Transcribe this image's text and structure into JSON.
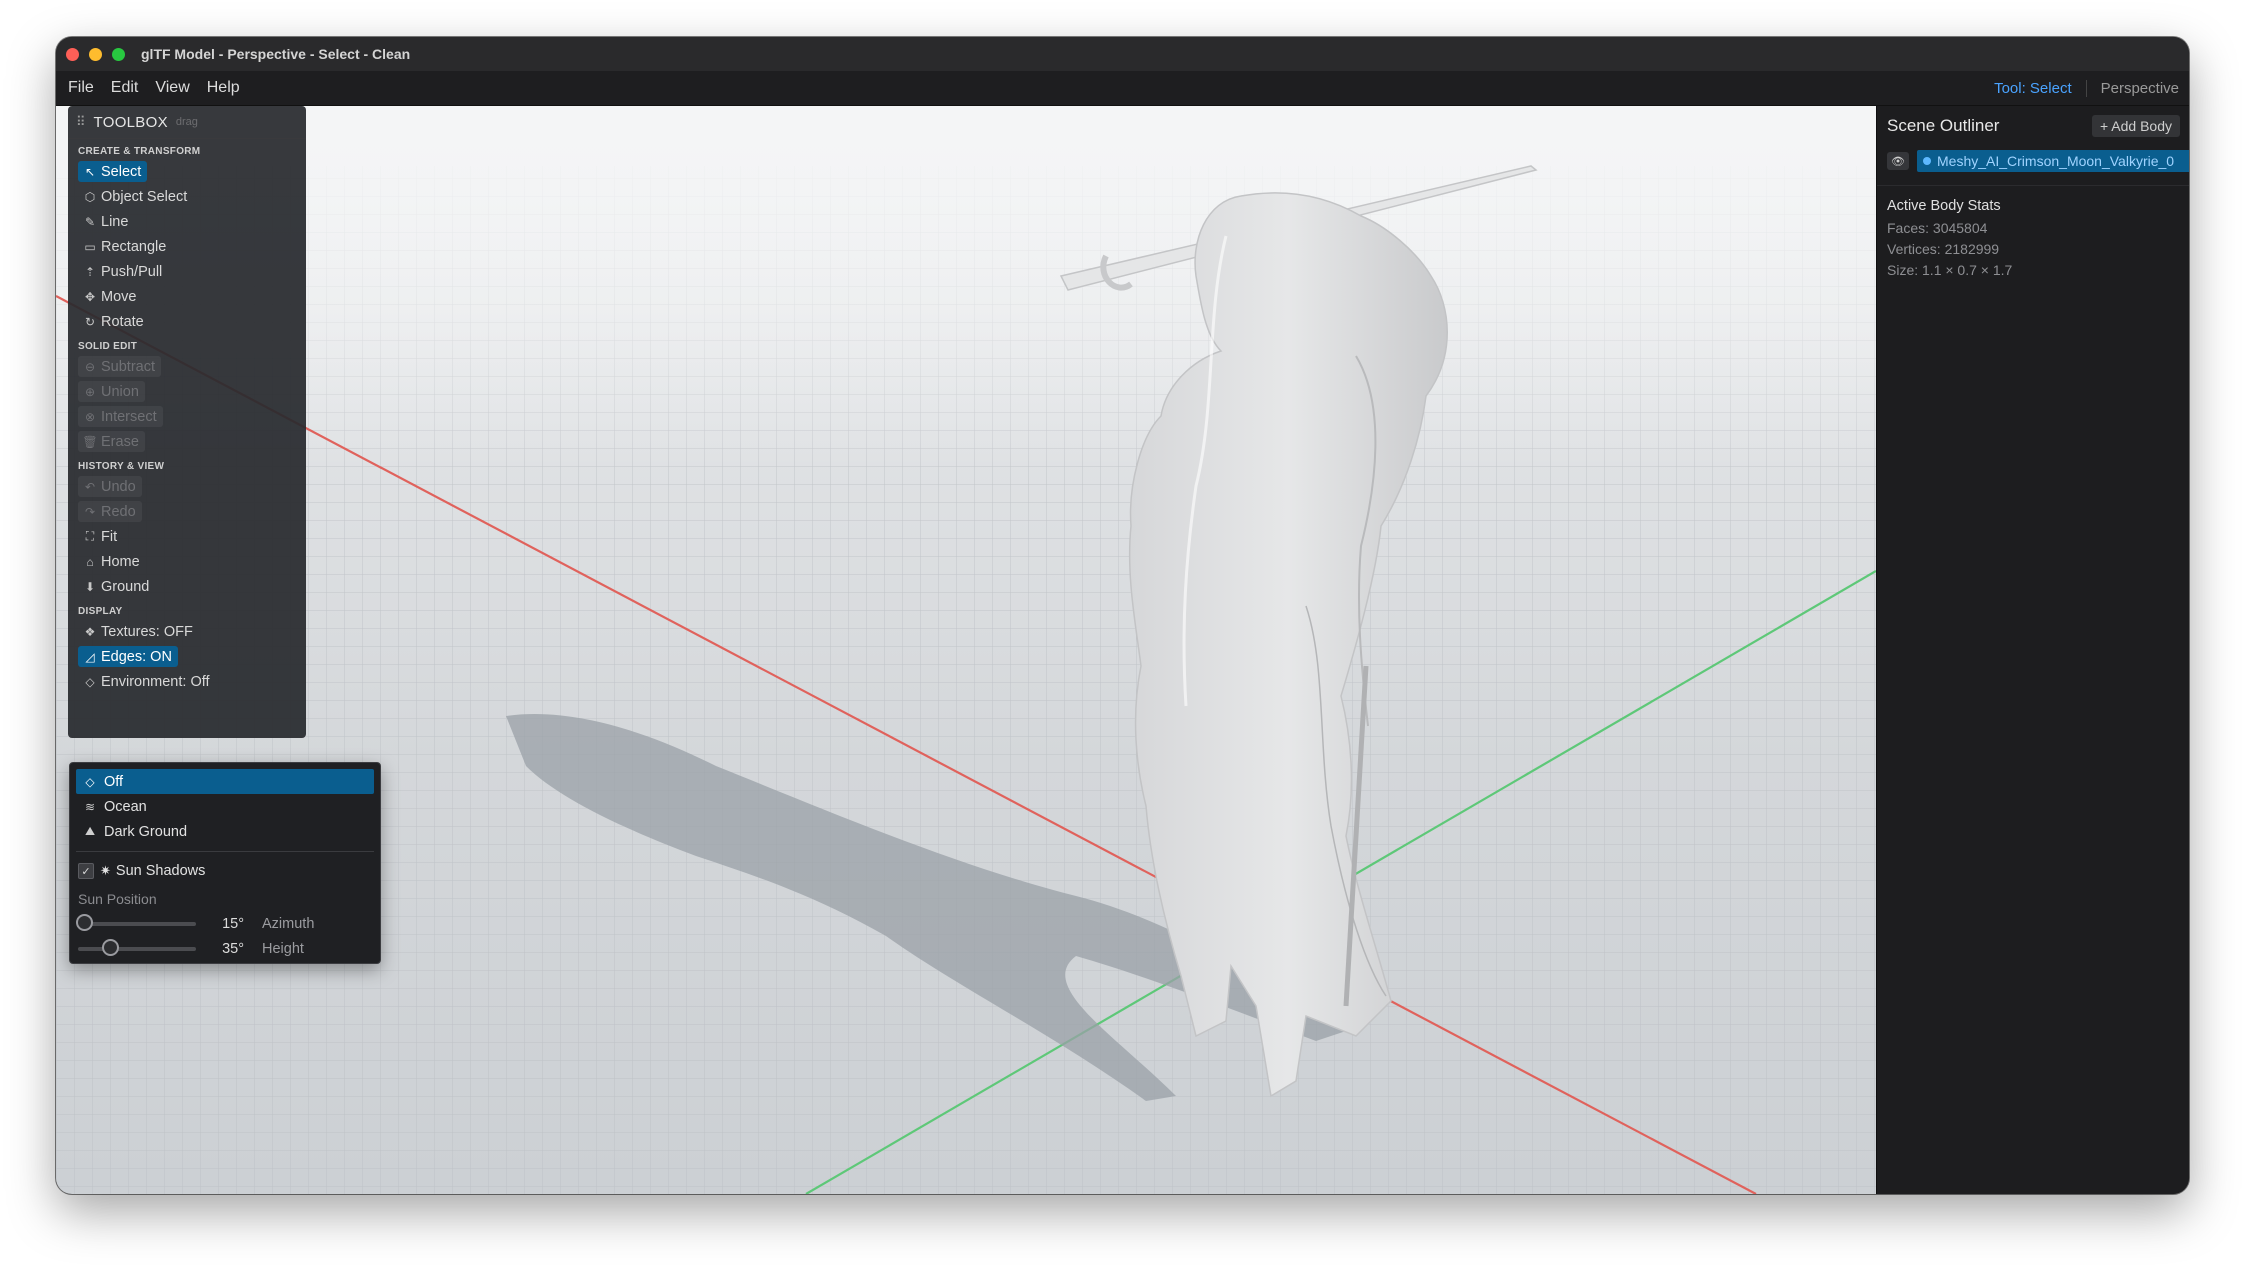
{
  "window": {
    "title": "glTF Model - Perspective - Select - Clean"
  },
  "menu": [
    "File",
    "Edit",
    "View",
    "Help"
  ],
  "status": {
    "tool": "Tool: Select",
    "view": "Perspective"
  },
  "colors": {
    "accent": "#0a5e8f",
    "link": "#4aa3ff",
    "axis_x": "#e0625c",
    "axis_z": "#5ec878"
  },
  "toolbox": {
    "title": "TOOLBOX",
    "drag_hint": "drag",
    "sections": [
      {
        "title": "CREATE & TRANSFORM",
        "items": [
          {
            "icon": "pointer-icon",
            "glyph": "↖",
            "label": "Select",
            "state": "active"
          },
          {
            "icon": "cube-icon",
            "glyph": "⬡",
            "label": "Object Select",
            "state": "normal"
          },
          {
            "icon": "pencil-icon",
            "glyph": "✎",
            "label": "Line",
            "state": "normal"
          },
          {
            "icon": "rectangle-icon",
            "glyph": "▭",
            "label": "Rectangle",
            "state": "normal"
          },
          {
            "icon": "push-pull-icon",
            "glyph": "⇡",
            "label": "Push/Pull",
            "state": "normal"
          },
          {
            "icon": "move-icon",
            "glyph": "✥",
            "label": "Move",
            "state": "normal"
          },
          {
            "icon": "rotate-icon",
            "glyph": "↻",
            "label": "Rotate",
            "state": "normal"
          }
        ]
      },
      {
        "title": "SOLID EDIT",
        "items": [
          {
            "icon": "subtract-icon",
            "glyph": "⊖",
            "label": "Subtract",
            "state": "disabled"
          },
          {
            "icon": "union-icon",
            "glyph": "⊕",
            "label": "Union",
            "state": "disabled"
          },
          {
            "icon": "intersect-icon",
            "glyph": "⊗",
            "label": "Intersect",
            "state": "disabled"
          },
          {
            "icon": "trash-icon",
            "glyph": "🗑",
            "label": "Erase",
            "state": "disabled"
          }
        ]
      },
      {
        "title": "HISTORY & VIEW",
        "items": [
          {
            "icon": "undo-icon",
            "glyph": "↶",
            "label": "Undo",
            "state": "disabled"
          },
          {
            "icon": "redo-icon",
            "glyph": "↷",
            "label": "Redo",
            "state": "disabled"
          },
          {
            "icon": "fit-icon",
            "glyph": "⛶",
            "label": "Fit",
            "state": "normal"
          },
          {
            "icon": "home-icon",
            "glyph": "⌂",
            "label": "Home",
            "state": "normal"
          },
          {
            "icon": "ground-icon",
            "glyph": "⬇",
            "label": "Ground",
            "state": "normal"
          }
        ]
      },
      {
        "title": "DISPLAY",
        "items": [
          {
            "icon": "texture-icon",
            "glyph": "❖",
            "label": "Textures: OFF",
            "state": "normal"
          },
          {
            "icon": "edges-icon",
            "glyph": "◿",
            "label": "Edges: ON",
            "state": "active"
          },
          {
            "icon": "environment-icon",
            "glyph": "◇",
            "label": "Environment: Off",
            "state": "normal"
          }
        ]
      }
    ]
  },
  "environment_dropdown": {
    "options": [
      {
        "icon": "diamond-icon",
        "glyph": "◇",
        "label": "Off",
        "selected": true
      },
      {
        "icon": "wave-icon",
        "glyph": "≋",
        "label": "Ocean",
        "selected": false
      },
      {
        "icon": "mountain-icon",
        "glyph": "⛰",
        "label": "Dark Ground",
        "selected": false
      }
    ],
    "sun_shadows": {
      "label": "Sun Shadows",
      "checked": true
    },
    "sun_position_label": "Sun Position",
    "sliders": [
      {
        "value": "15°",
        "label": "Azimuth",
        "level": 0.05
      },
      {
        "value": "35°",
        "label": "Height",
        "level": 0.27
      }
    ]
  },
  "outliner": {
    "title": "Scene Outliner",
    "add_button": "+ Add Body",
    "body_name": "Meshy_AI_Crimson_Moon_Valkyrie_0",
    "stats_title": "Active Body Stats",
    "faces": "Faces: 3045804",
    "vertices": "Vertices: 2182999",
    "size": "Size: 1.1 × 0.7 × 1.7"
  }
}
